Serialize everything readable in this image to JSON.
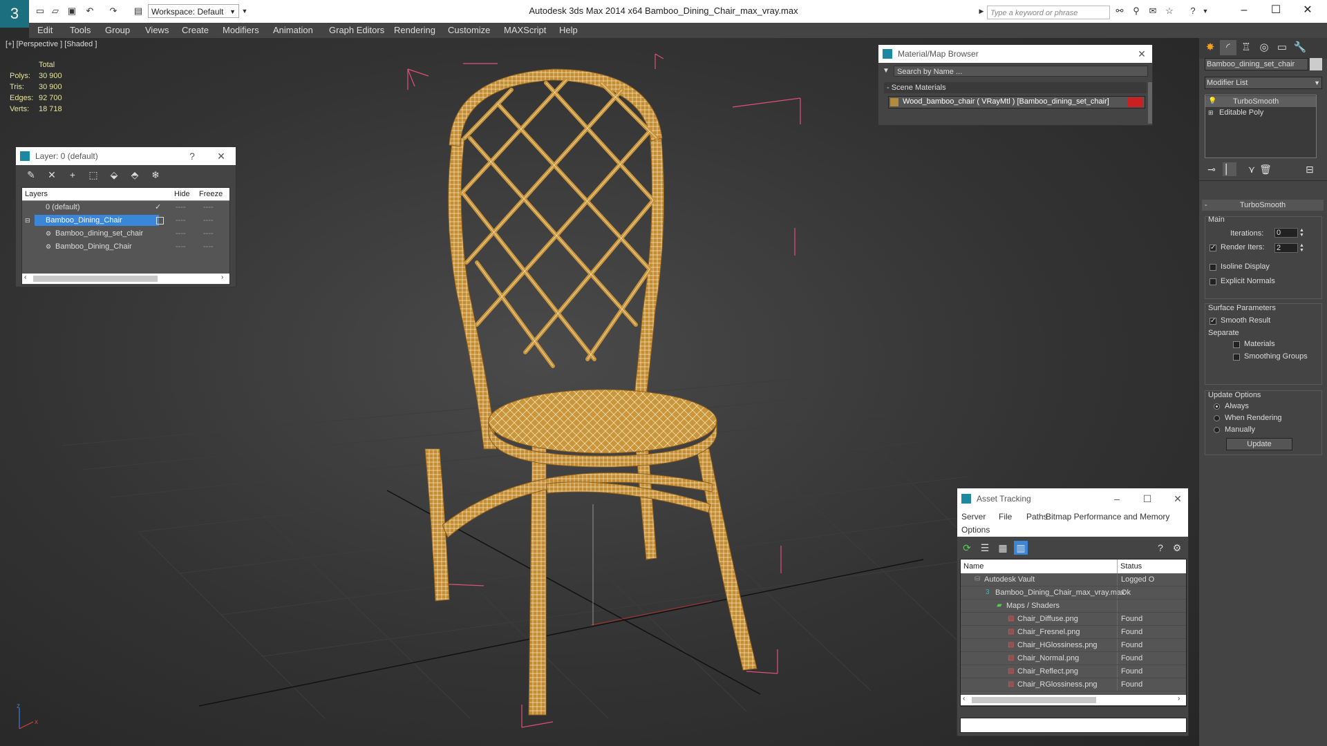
{
  "app": {
    "title": "Autodesk 3ds Max  2014 x64     Bamboo_Dining_Chair_max_vray.max",
    "logo": "3",
    "workspace": "Workspace: Default",
    "search_placeholder": "Type a keyword or phrase"
  },
  "menu": [
    "Edit",
    "Tools",
    "Group",
    "Views",
    "Create",
    "Modifiers",
    "Animation",
    "Graph Editors",
    "Rendering",
    "Customize",
    "MAXScript",
    "Help"
  ],
  "viewport": {
    "label": "[+] [Perspective ] [Shaded ]",
    "stats": {
      "header": "Total",
      "rows": [
        {
          "label": "Polys:",
          "value": "30 900"
        },
        {
          "label": "Tris:",
          "value": "30 900"
        },
        {
          "label": "Edges:",
          "value": "92 700"
        },
        {
          "label": "Verts:",
          "value": "18 718"
        }
      ]
    },
    "axis": {
      "x": "x",
      "z": "z"
    }
  },
  "layer_panel": {
    "title": "Layer: 0 (default)",
    "help": "?",
    "close": "✕",
    "columns": {
      "name": "Layers",
      "hide": "Hide",
      "freeze": "Freeze"
    },
    "rows": [
      {
        "name": "0 (default)",
        "hide": "----",
        "freeze": "----"
      },
      {
        "name": "Bamboo_Dining_Chair",
        "hide": "----",
        "freeze": "----"
      },
      {
        "name": "Bamboo_dining_set_chair",
        "hide": "----",
        "freeze": "----"
      },
      {
        "name": "Bamboo_Dining_Chair",
        "hide": "----",
        "freeze": "----"
      }
    ]
  },
  "material_browser": {
    "title": "Material/Map Browser",
    "close": "✕",
    "search": "Search by Name ...",
    "section": "- Scene Materials",
    "item": "Wood_bamboo_chair  ( VRayMtl ) [Bamboo_dining_set_chair]"
  },
  "asset_tracking": {
    "title": "Asset Tracking",
    "menu": [
      "Server",
      "File",
      "Paths",
      "Bitmap Performance and Memory",
      "Options"
    ],
    "columns": {
      "name": "Name",
      "status": "Status"
    },
    "rows": [
      {
        "name": "Autodesk Vault",
        "status": "Logged O",
        "indent": 0,
        "icon": "vault-icon"
      },
      {
        "name": "Bamboo_Dining_Chair_max_vray.max",
        "status": "Ok",
        "indent": 1,
        "icon": "max-file-icon"
      },
      {
        "name": "Maps / Shaders",
        "status": "",
        "indent": 2,
        "icon": "folder-icon"
      },
      {
        "name": "Chair_Diffuse.png",
        "status": "Found",
        "indent": 3,
        "icon": "png-icon"
      },
      {
        "name": "Chair_Fresnel.png",
        "status": "Found",
        "indent": 3,
        "icon": "png-icon"
      },
      {
        "name": "Chair_HGlossiness.png",
        "status": "Found",
        "indent": 3,
        "icon": "png-icon"
      },
      {
        "name": "Chair_Normal.png",
        "status": "Found",
        "indent": 3,
        "icon": "png-icon"
      },
      {
        "name": "Chair_Reflect.png",
        "status": "Found",
        "indent": 3,
        "icon": "png-icon"
      },
      {
        "name": "Chair_RGlossiness.png",
        "status": "Found",
        "indent": 3,
        "icon": "png-icon"
      }
    ]
  },
  "command_panel": {
    "object_name": "Bamboo_dining_set_chair",
    "modifier_list": "Modifier List",
    "stack": [
      "TurboSmooth",
      "Editable Poly"
    ],
    "rollout": "TurboSmooth",
    "main": "Main",
    "iterations_label": "Iterations:",
    "iterations": "0",
    "render_iters_label": "Render Iters:",
    "render_iters": "2",
    "isoline": "Isoline Display",
    "explicit_normals": "Explicit Normals",
    "surface_params": "Surface Parameters",
    "smooth_result": "Smooth Result",
    "separate": "Separate",
    "materials": "Materials",
    "smoothing_groups": "Smoothing Groups",
    "update_options": "Update Options",
    "always": "Always",
    "when_rendering": "When Rendering",
    "manually": "Manually",
    "update_button": "Update"
  },
  "colors": {
    "accent": "#1b6f7e",
    "selection": "#3a86d9",
    "bamboo": "#c9953d",
    "material_swatch": "#cc1f1f",
    "bbox": "#e0507a"
  }
}
